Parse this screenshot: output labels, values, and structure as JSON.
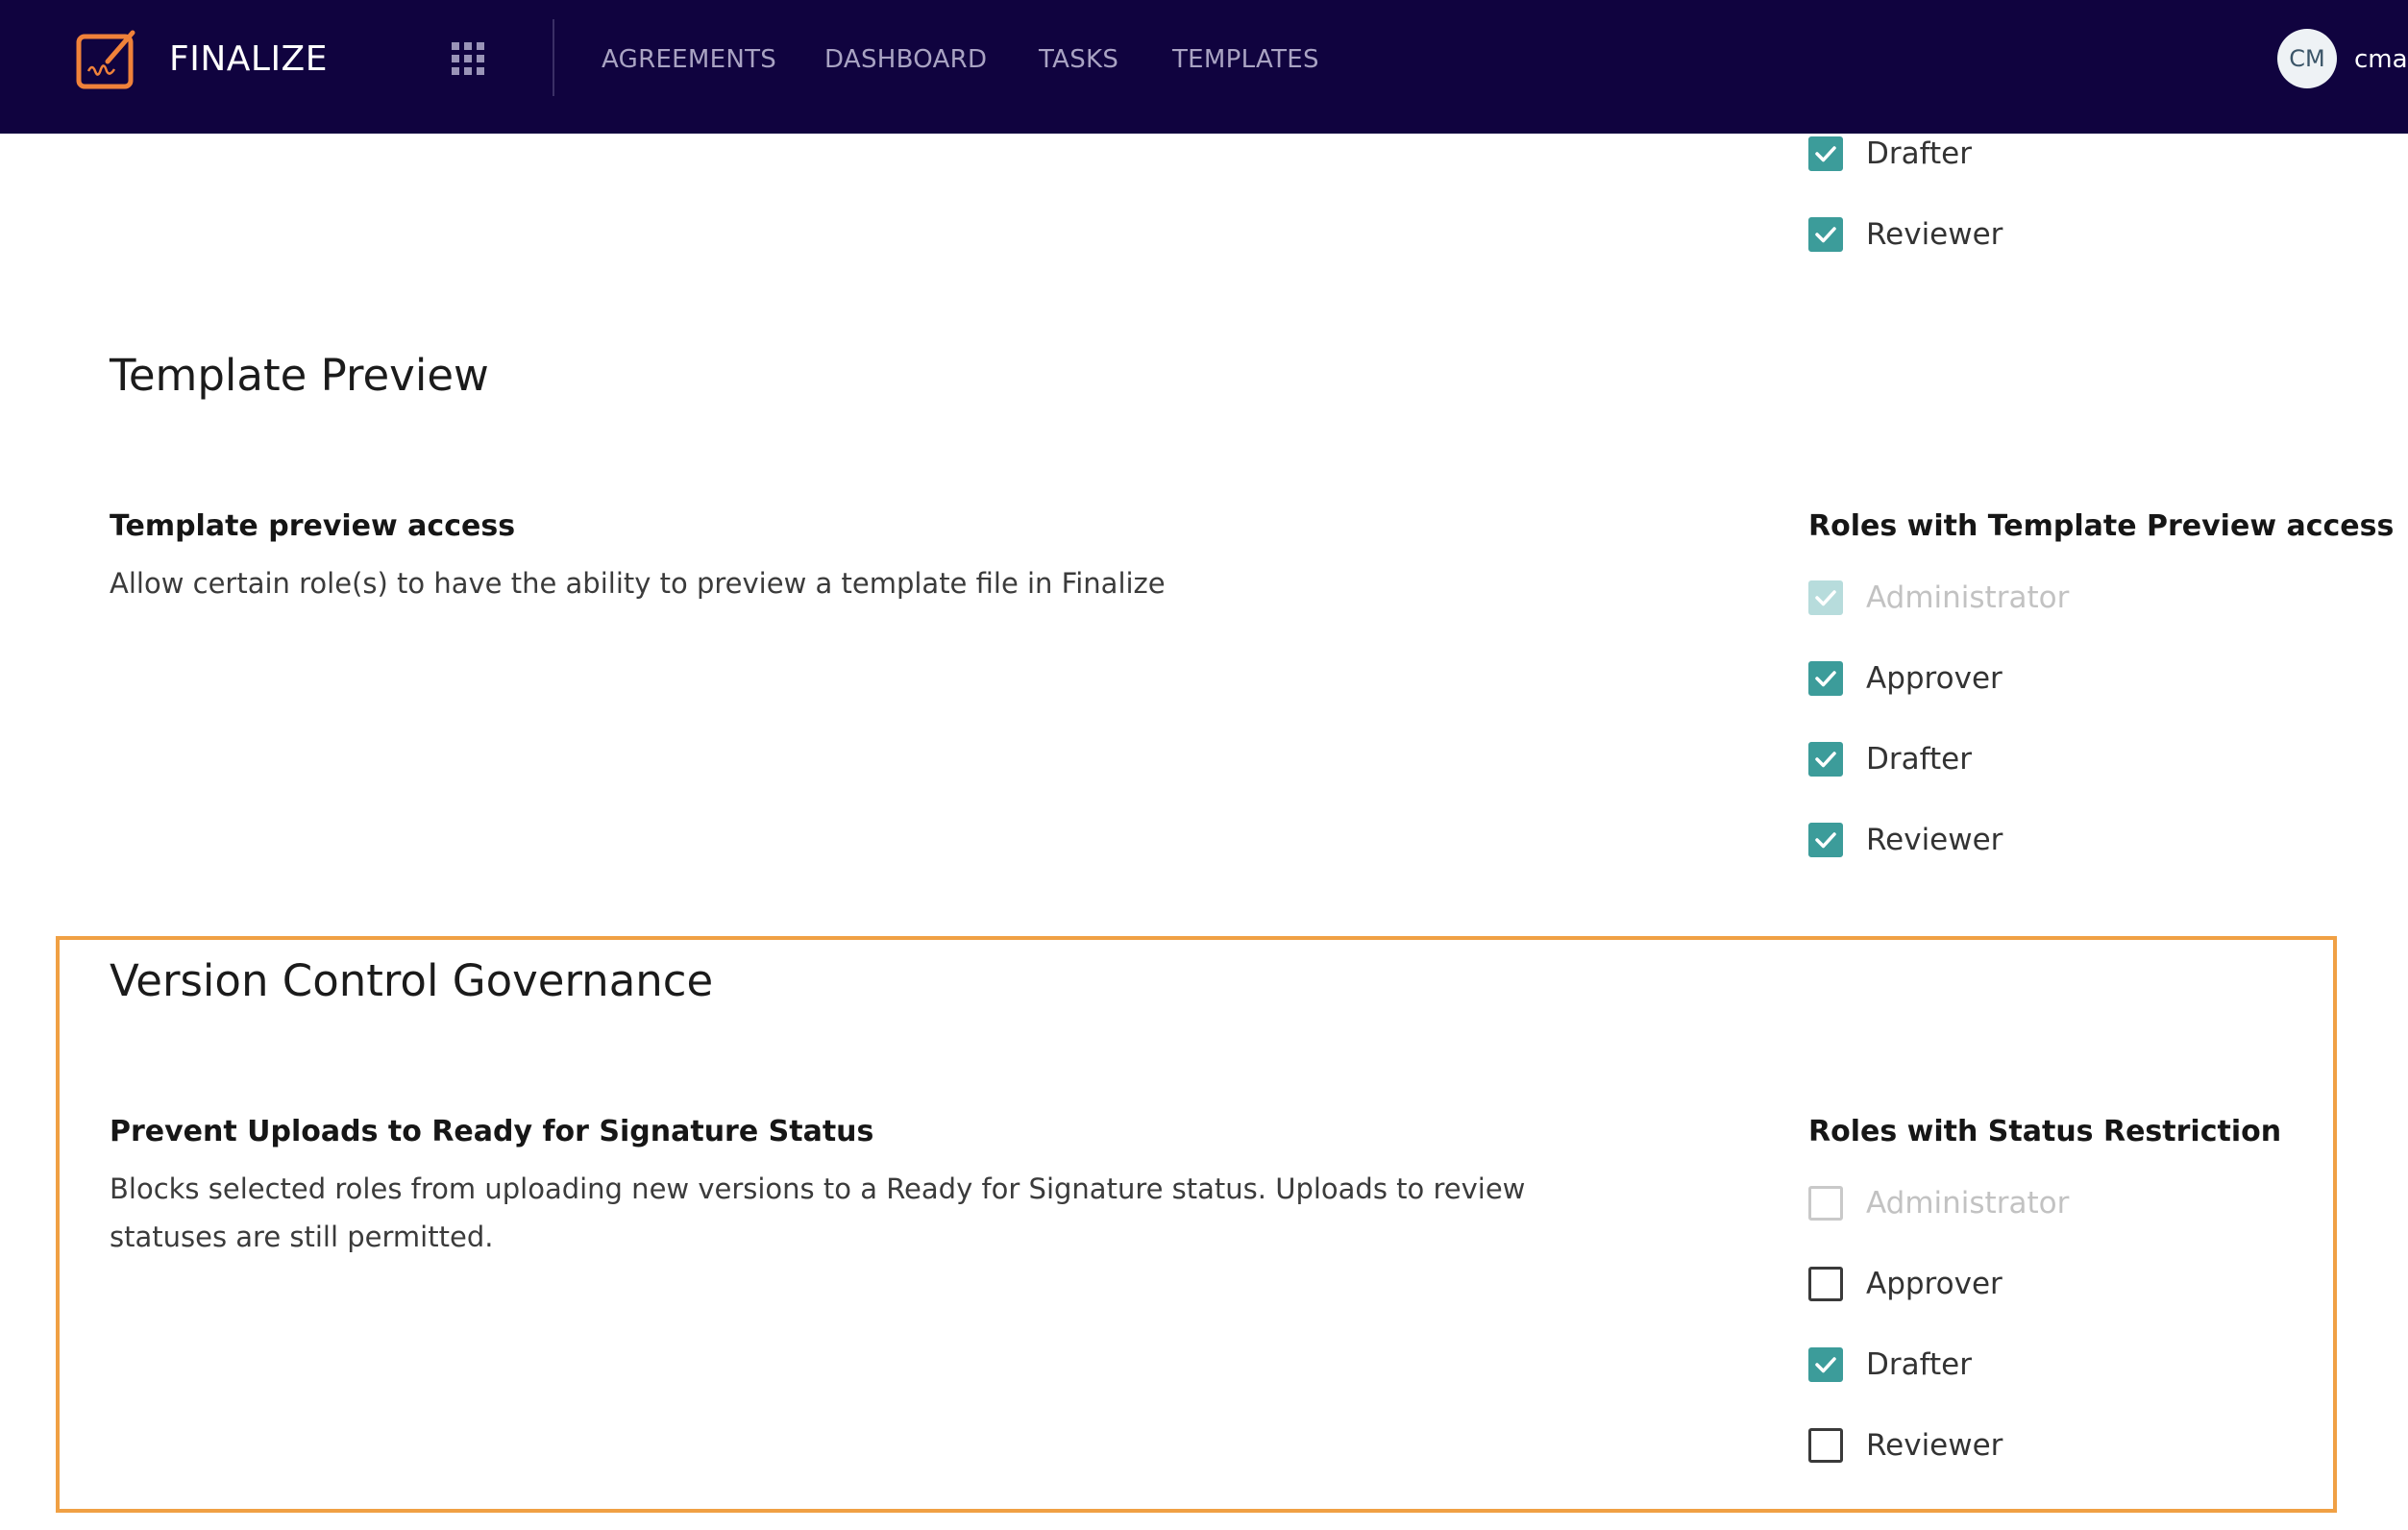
{
  "app": {
    "brand": "FINALIZE",
    "logo_color": "#f0823a",
    "nav_bg": "#10033f",
    "nav_items": [
      "AGREEMENTS",
      "DASHBOARD",
      "TASKS",
      "TEMPLATES"
    ],
    "user": {
      "initials": "CM",
      "name": "cmat"
    }
  },
  "top_partial_roles": [
    {
      "label": "Drafter",
      "checked": true,
      "disabled": false
    },
    {
      "label": "Reviewer",
      "checked": true,
      "disabled": false
    }
  ],
  "template_preview": {
    "section_title": "Template Preview",
    "setting_title": "Template preview access",
    "setting_desc": "Allow certain role(s) to have the ability to preview a template file in Finalize",
    "roles_title": "Roles with Template Preview access",
    "roles": [
      {
        "label": "Administrator",
        "checked": true,
        "disabled": true
      },
      {
        "label": "Approver",
        "checked": true,
        "disabled": false
      },
      {
        "label": "Drafter",
        "checked": true,
        "disabled": false
      },
      {
        "label": "Reviewer",
        "checked": true,
        "disabled": false
      }
    ]
  },
  "version_control": {
    "section_title": "Version Control Governance",
    "setting_title": "Prevent Uploads to Ready for Signature Status",
    "setting_desc": "Blocks selected roles from uploading new versions to a Ready for Signature status. Uploads to review statuses are still permitted.",
    "roles_title": "Roles with Status Restriction",
    "roles": [
      {
        "label": "Administrator",
        "checked": false,
        "disabled": true
      },
      {
        "label": "Approver",
        "checked": false,
        "disabled": false
      },
      {
        "label": "Drafter",
        "checked": true,
        "disabled": false
      },
      {
        "label": "Reviewer",
        "checked": false,
        "disabled": false
      }
    ],
    "highlight_color": "#f0a044"
  },
  "colors": {
    "checkbox_checked": "#3c9c9a",
    "checkbox_disabled_checked": "#b7dcdc"
  }
}
